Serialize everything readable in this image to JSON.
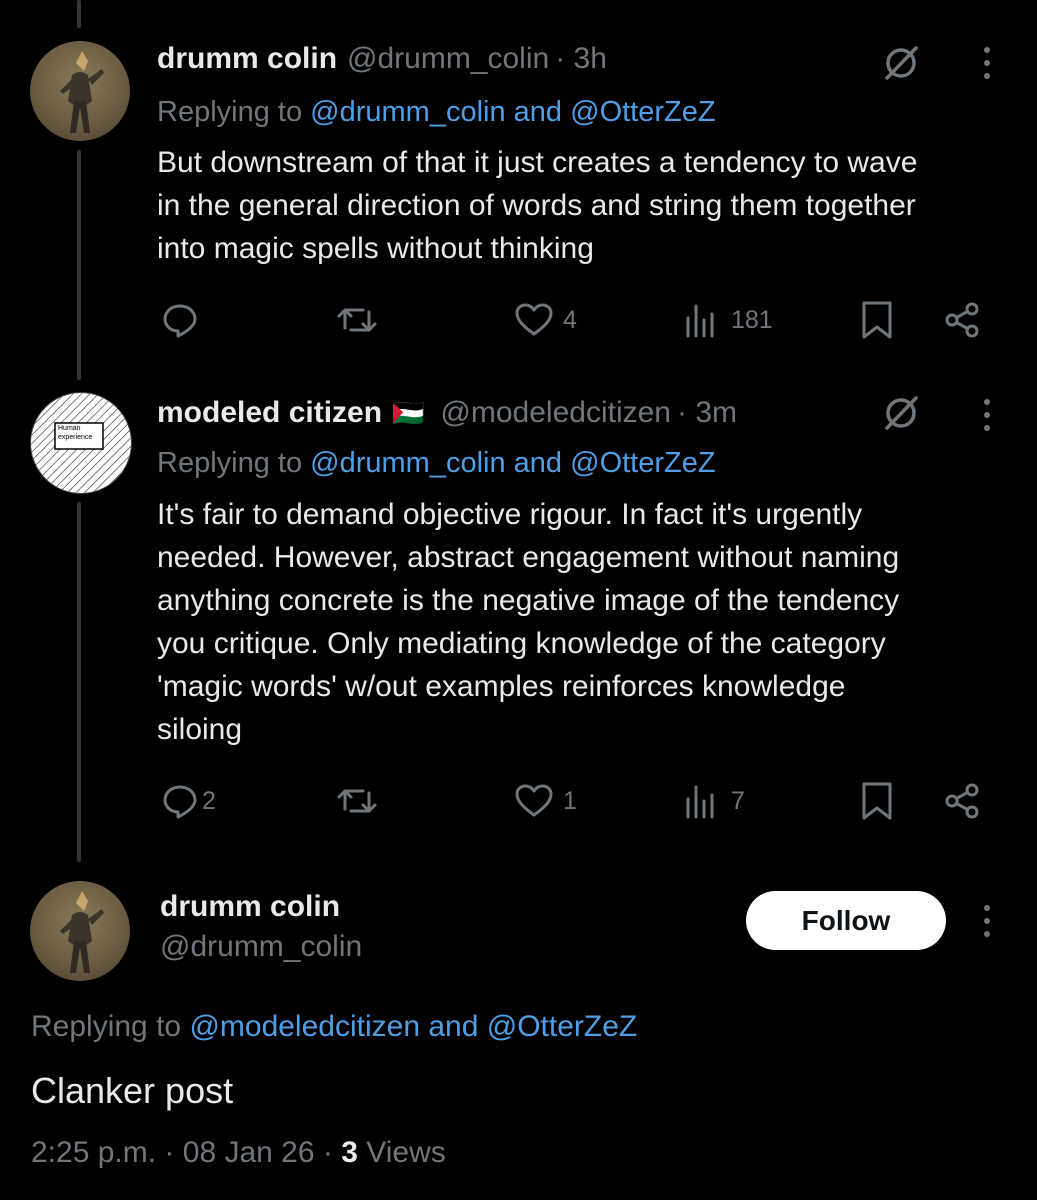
{
  "posts": [
    {
      "name": "drumm colin",
      "handle": "@drumm_colin",
      "time": "· 3h",
      "replying_prefix": "Replying to",
      "replying_to_1": "@drumm_colin",
      "replying_and": "and",
      "replying_to_2": "@OtterZeZ",
      "text_lines": [
        "But downstream of that it just creates a tendency to wave",
        "in the general direction of words and string them together",
        "into magic spells without thinking"
      ],
      "replies": "",
      "likes": "4",
      "views": "181"
    },
    {
      "name": "modeled citizen",
      "flag": "🇵🇸",
      "handle": "@modeledcitizen",
      "time": "· 3m",
      "avatar_text_1": "Human",
      "avatar_text_2": "experience",
      "replying_prefix": "Replying to",
      "replying_to_1": "@drumm_colin",
      "replying_and": "and",
      "replying_to_2": "@OtterZeZ",
      "text_lines": [
        "It's fair to demand objective rigour. In fact it's urgently",
        "needed. However, abstract engagement without naming",
        "anything concrete is the negative image of the tendency",
        "you critique. Only mediating knowledge of the category",
        "'magic words' w/out examples reinforces knowledge",
        "siloing"
      ],
      "replies": "2",
      "likes": "1",
      "views": "7"
    }
  ],
  "main_post": {
    "name": "drumm colin",
    "handle": "@drumm_colin",
    "follow_label": "Follow",
    "replying_prefix": "Replying to",
    "replying_to_1": "@modeledcitizen",
    "replying_and": "and",
    "replying_to_2": "@OtterZeZ",
    "text": "Clanker post",
    "time": "2:25 p.m.",
    "sep1": "·",
    "date": "08 Jan 26",
    "sep2": "·",
    "views_count": "3",
    "views_label": "Views"
  },
  "colors": {
    "background": "#000000",
    "text": "#e7e9ea",
    "muted": "#71767b",
    "link": "#4f9ee6",
    "button_bg": "#ffffff"
  },
  "icons": [
    "grok-icon",
    "more-icon",
    "reply-icon",
    "retweet-icon",
    "like-icon",
    "views-icon",
    "bookmark-icon",
    "share-icon"
  ]
}
